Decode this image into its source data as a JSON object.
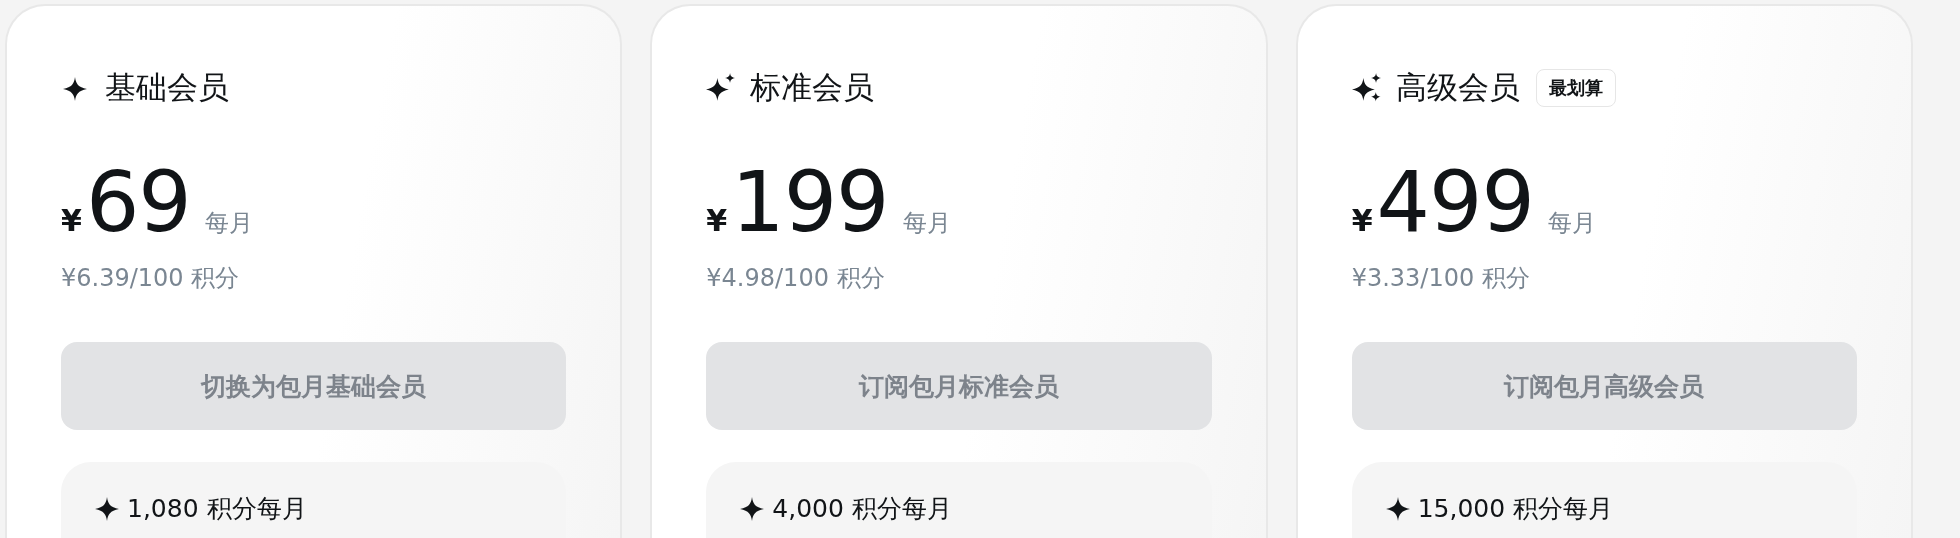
{
  "plans": [
    {
      "kind": "single",
      "name": "基础会员",
      "currency": "¥",
      "price": "69",
      "period": "每月",
      "unit_price": "¥6.39/100 积分",
      "button": {
        "label": "切换为包月基础会员",
        "disabled": true
      },
      "features": [
        "1,080 积分每月"
      ]
    },
    {
      "kind": "double",
      "name": "标准会员",
      "currency": "¥",
      "price": "199",
      "period": "每月",
      "unit_price": "¥4.98/100 积分",
      "button": {
        "label": "订阅包月标准会员",
        "disabled": true
      },
      "features": [
        "4,000 积分每月"
      ]
    },
    {
      "kind": "triple",
      "name": "高级会员",
      "badge": "最划算",
      "currency": "¥",
      "price": "499",
      "period": "每月",
      "unit_price": "¥3.33/100 积分",
      "button": {
        "label": "订阅包月高级会员",
        "disabled": true
      },
      "features": [
        "15,000 积分每月"
      ]
    }
  ]
}
